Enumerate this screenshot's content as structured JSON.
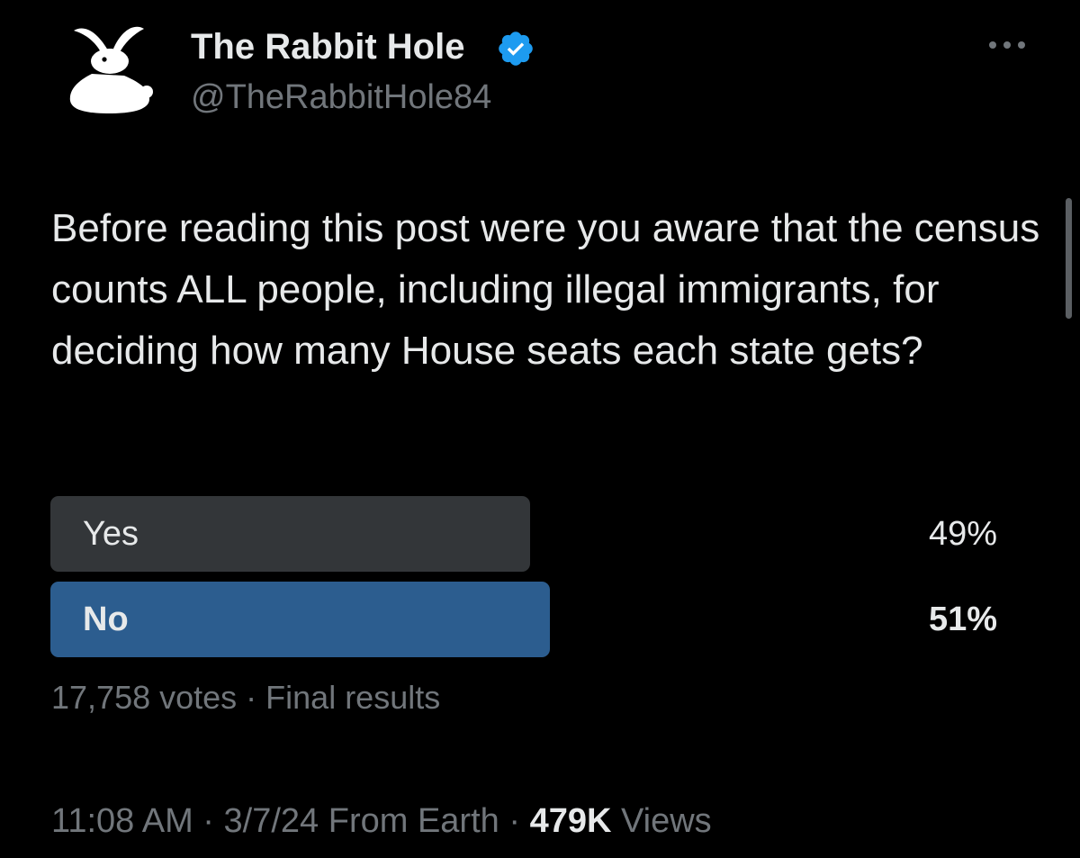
{
  "author": {
    "display_name": "The Rabbit Hole",
    "handle": "@TheRabbitHole84",
    "verified": true,
    "avatar_icon": "rabbit-icon"
  },
  "post": {
    "text": "Before reading this post were you aware that the census counts ALL people, including illegal immigrants, for deciding how many House seats each state gets?"
  },
  "poll": {
    "options": [
      {
        "label": "Yes",
        "percent": "49%",
        "value": 49,
        "winner": false
      },
      {
        "label": "No",
        "percent": "51%",
        "value": 51,
        "winner": true
      }
    ],
    "votes": "17,758 votes",
    "separator": " · ",
    "status": "Final results"
  },
  "meta": {
    "time": "11:08 AM",
    "date": "3/7/24",
    "source": "From Earth",
    "separator": " · ",
    "views_count": "479K",
    "views_label": "Views"
  },
  "colors": {
    "background": "#000000",
    "text_primary": "#e7e9ea",
    "text_secondary": "#71767b",
    "verified_blue": "#1d9bf0",
    "poll_loser": "#333639",
    "poll_winner": "#2c5d8f"
  }
}
